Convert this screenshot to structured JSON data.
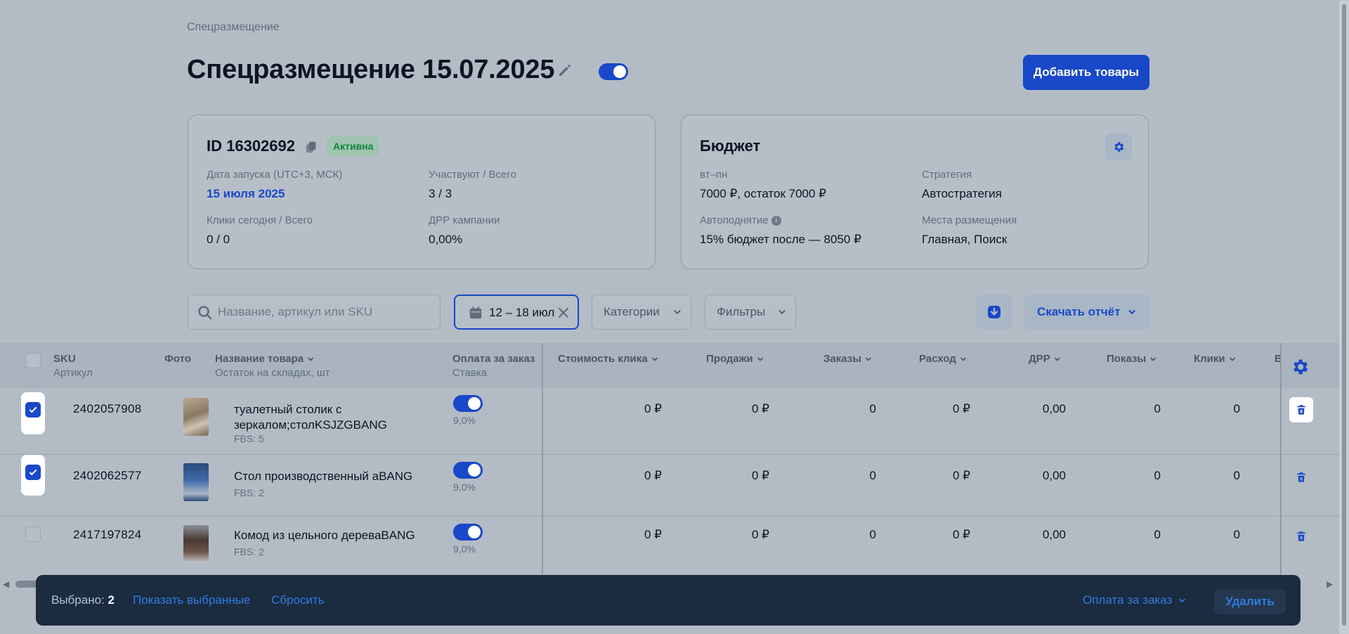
{
  "breadcrumb": "Спецразмещение",
  "page_title": "Спецразмещение 15.07.2025",
  "add_button_label": "Добавить товары",
  "campaign": {
    "id_label": "ID 16302692",
    "status": "Активна",
    "launch_label": "Дата запуска (UTC+3, МСК)",
    "launch_value": "15 июля 2025",
    "participants_label": "Участвуют / Всего",
    "participants_value": "3 / 3",
    "clicks_label": "Клики сегодня / Всего",
    "clicks_value": "0 / 0",
    "drr_label": "ДРР кампании",
    "drr_value": "0,00%"
  },
  "budget": {
    "title": "Бюджет",
    "period_label": "вт–пн",
    "period_value": "7000 ₽, остаток 7000 ₽",
    "strategy_label": "Стратегия",
    "strategy_value": "Автостратегия",
    "autoraise_label": "Автоподнятие",
    "autoraise_value": "15% бюджет после — 8050 ₽",
    "places_label": "Места размещения",
    "places_value": "Главная, Поиск"
  },
  "toolbar": {
    "search_placeholder": "Название, артикул или SKU",
    "date_range": "12 – 18 июл",
    "categories_label": "Категории",
    "filters_label": "Фильтры",
    "download_report_label": "Скачать отчёт"
  },
  "table": {
    "headers": {
      "sku": "SKU",
      "sku_sub": "Артикул",
      "photo": "Фото",
      "name": "Название товара",
      "name_sub": "Остаток на складах, шт",
      "pay": "Оплата за заказ",
      "pay_sub": "Ставка",
      "click_cost": "Стоимость клика",
      "sales": "Продажи",
      "orders": "Заказы",
      "spend": "Расход",
      "drr": "ДРР",
      "views": "Показы",
      "clicks": "Клики",
      "more": "В"
    },
    "rows": [
      {
        "selected": true,
        "sku": "2402057908",
        "name": "туалетный столик с зеркалом;столKSJZGBANG",
        "stock": "FBS: 5",
        "rate": "9,0%",
        "click_cost": "0 ₽",
        "sales": "0 ₽",
        "orders": "0",
        "spend": "0 ₽",
        "drr": "0,00",
        "views": "0",
        "clicks": "0"
      },
      {
        "selected": true,
        "sku": "2402062577",
        "name": "Стол производственный аBANG",
        "stock": "FBS: 2",
        "rate": "9,0%",
        "click_cost": "0 ₽",
        "sales": "0 ₽",
        "orders": "0",
        "spend": "0 ₽",
        "drr": "0,00",
        "views": "0",
        "clicks": "0"
      },
      {
        "selected": false,
        "sku": "2417197824",
        "name": "Комод из цельного дереваBANG",
        "stock": "FBS: 2",
        "rate": "9,0%",
        "click_cost": "0 ₽",
        "sales": "0 ₽",
        "orders": "0",
        "spend": "0 ₽",
        "drr": "0,00",
        "views": "0",
        "clicks": "0"
      }
    ]
  },
  "bottom_bar": {
    "selected_label": "Выбрано:",
    "selected_count": "2",
    "show_selected": "Показать выбранные",
    "reset": "Сбросить",
    "pay_for_order": "Оплата за заказ",
    "delete": "Удалить"
  },
  "colors": {
    "accent": "#1948c8",
    "status_green": "#10823f",
    "bottom_bar": "#1b2b40"
  }
}
